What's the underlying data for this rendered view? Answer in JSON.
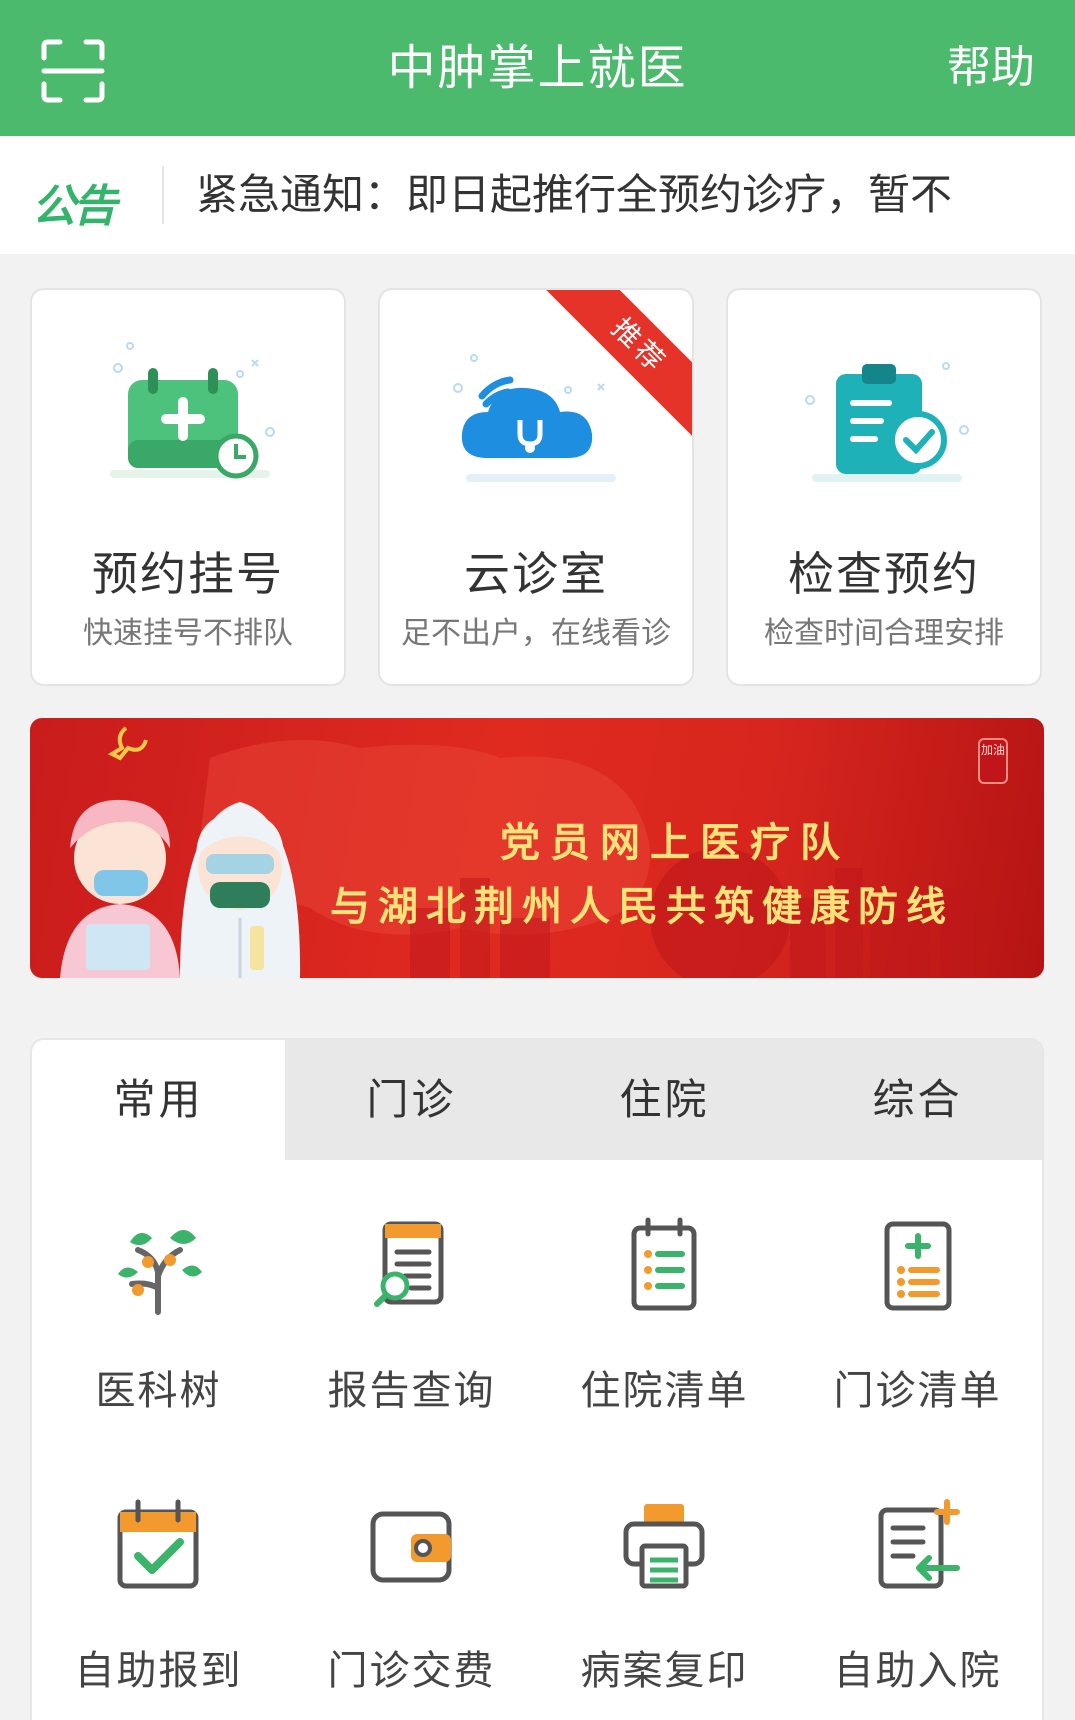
{
  "header": {
    "title": "中肿掌上就医",
    "help_label": "帮助",
    "scan_icon": "scan-icon",
    "background_color": "#4cba6c"
  },
  "notice": {
    "tag": "公告",
    "text": "紧急通知：即日起推行全预约诊疗，暂不"
  },
  "service_cards": [
    {
      "title": "预约挂号",
      "subtitle": "快速挂号不排队",
      "icon": "calendar-plus-icon"
    },
    {
      "title": "云诊室",
      "subtitle": "足不出户，在线看诊",
      "icon": "cloud-stethoscope-icon",
      "badge": "推荐"
    },
    {
      "title": "检查预约",
      "subtitle": "检查时间合理安排",
      "icon": "clipboard-check-icon"
    }
  ],
  "banner": {
    "line1": "党员网上医疗队",
    "line2": "与湖北荆州人民共筑健康防线",
    "seal": "加油"
  },
  "tabs": [
    "常用",
    "门诊",
    "住院",
    "综合"
  ],
  "active_tab": "常用",
  "grid_items": [
    {
      "label": "医科树",
      "icon": "tree-icon"
    },
    {
      "label": "报告查询",
      "icon": "report-search-icon"
    },
    {
      "label": "住院清单",
      "icon": "inpatient-list-icon"
    },
    {
      "label": "门诊清单",
      "icon": "outpatient-list-icon"
    },
    {
      "label": "自助报到",
      "icon": "calendar-check-icon"
    },
    {
      "label": "门诊交费",
      "icon": "wallet-icon"
    },
    {
      "label": "病案复印",
      "icon": "printer-icon"
    },
    {
      "label": "自助入院",
      "icon": "admission-icon"
    }
  ],
  "colors": {
    "brand_green": "#4cba6c",
    "notice_green": "#33b46a",
    "badge_red": "#e5332a",
    "icon_orange": "#f39a2e",
    "icon_green": "#3bb36a",
    "icon_dark": "#555555"
  }
}
